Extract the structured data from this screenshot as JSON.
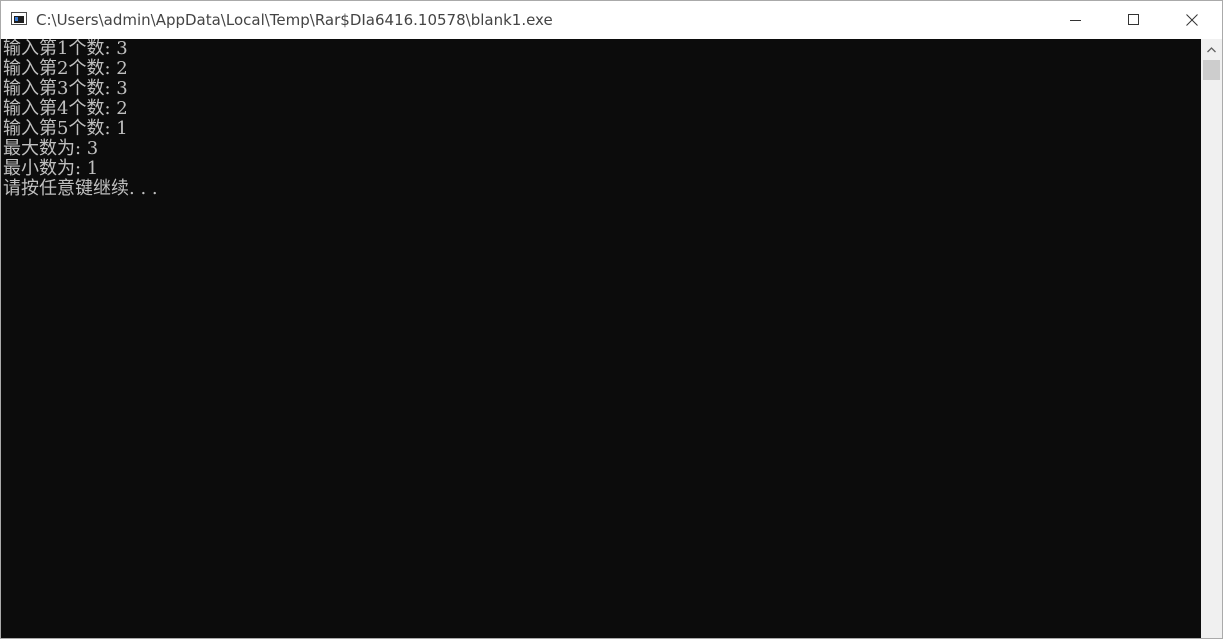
{
  "window": {
    "title": "C:\\Users\\admin\\AppData\\Local\\Temp\\Rar$DIa6416.10578\\blank1.exe",
    "controls": {
      "minimize_icon": "minimize-icon",
      "maximize_icon": "maximize-icon",
      "close_icon": "close-icon"
    }
  },
  "console": {
    "background": "#0c0c0c",
    "foreground": "#c0c0c0",
    "lines": [
      "输入第1个数: 3",
      "输入第2个数: 2",
      "输入第3个数: 3",
      "输入第4个数: 2",
      "输入第5个数: 1",
      "最大数为: 3",
      "最小数为: 1",
      "请按任意键继续. . ."
    ]
  },
  "scrollbar": {
    "up_icon": "chevron-up-icon"
  }
}
